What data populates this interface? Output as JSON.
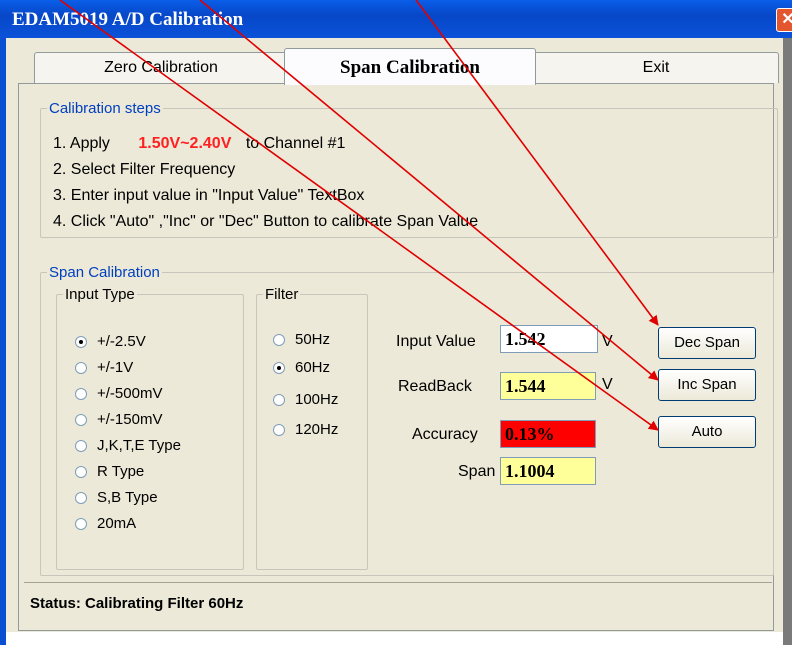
{
  "window": {
    "title": "EDAM5019 A/D Calibration",
    "close_label": "✕"
  },
  "tabs": [
    "Zero Calibration",
    "Span Calibration",
    "Exit"
  ],
  "steps": {
    "legend": "Calibration steps",
    "step1_prefix": "1. Apply",
    "step1_range": "1.50V~2.40V",
    "step1_suffix": "to Channel #1",
    "step2": "2. Select Filter Frequency",
    "step3": "3. Enter input value in \"Input Value\" TextBox",
    "step4": "4. Click \"Auto\" ,\"Inc\" or \"Dec\" Button to calibrate Span Value"
  },
  "span_group": {
    "legend": "Span Calibration"
  },
  "input_type": {
    "legend": "Input Type",
    "options": [
      "+/-2.5V",
      "+/-1V",
      "+/-500mV",
      "+/-150mV",
      "J,K,T,E Type",
      "R Type",
      "S,B Type",
      "20mA"
    ],
    "selected": "+/-2.5V"
  },
  "filter": {
    "legend": "Filter",
    "options": [
      "50Hz",
      "60Hz",
      "100Hz",
      "120Hz"
    ],
    "selected": "60Hz"
  },
  "fields": {
    "input_value_label": "Input Value",
    "input_value": "1.542",
    "input_value_unit": "V",
    "readback_label": "ReadBack",
    "readback": "1.544",
    "readback_unit": "V",
    "accuracy_label": "Accuracy",
    "accuracy": "0.13%",
    "span_label": "Span",
    "span": "1.1004"
  },
  "buttons": {
    "dec_span": "Dec Span",
    "inc_span": "Inc Span",
    "auto": "Auto"
  },
  "status": {
    "text": "Status: Calibrating Filter 60Hz"
  },
  "colors": {
    "title_bar": "#0a52d9",
    "readback_bg": "#ffff99",
    "accuracy_bg": "#ff0000",
    "arrow": "#e00000",
    "steps_range": "#ff2020"
  }
}
